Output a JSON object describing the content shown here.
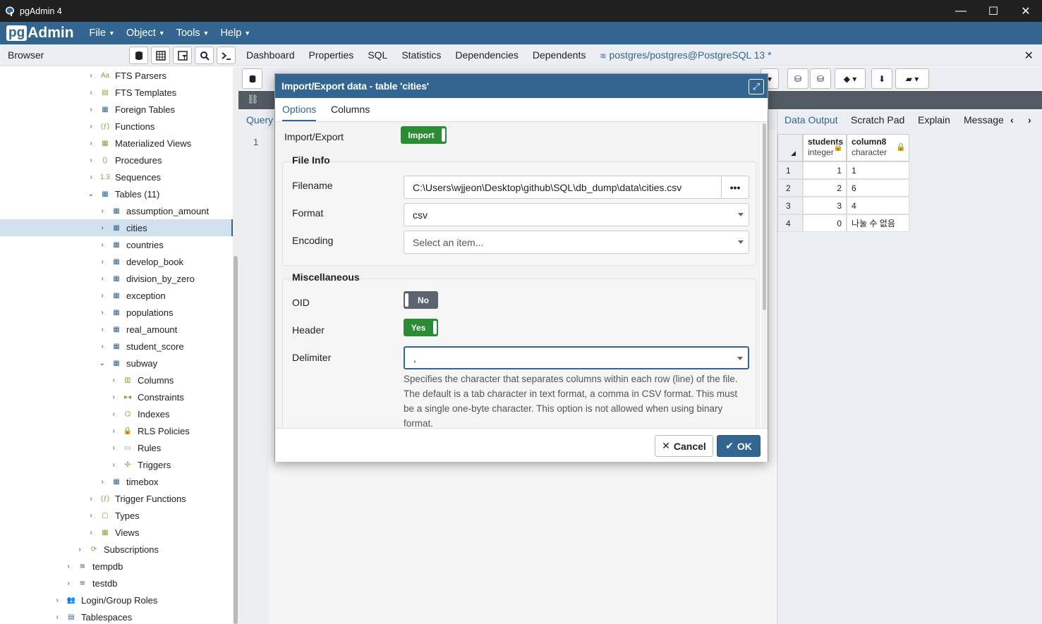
{
  "window": {
    "title": "pgAdmin 4",
    "minimize": "—",
    "maximize": "☐",
    "close": "✕"
  },
  "menubar": {
    "logo_pg": "pg",
    "logo_admin": "Admin",
    "items": [
      "File",
      "Object",
      "Tools",
      "Help"
    ]
  },
  "browser": {
    "title": "Browser",
    "tree": [
      {
        "label": "FTS Parsers",
        "icon": "fts-parsers-icon",
        "glyph": "Aa",
        "indent": 1,
        "chev": "›"
      },
      {
        "label": "FTS Templates",
        "icon": "fts-templates-icon",
        "glyph": "▤",
        "indent": 1,
        "chev": "›"
      },
      {
        "label": "Foreign Tables",
        "icon": "foreign-table-icon",
        "glyph": "▦",
        "indent": 1,
        "chev": "›"
      },
      {
        "label": "Functions",
        "icon": "function-icon",
        "glyph": "(ƒ)",
        "indent": 1,
        "chev": "›"
      },
      {
        "label": "Materialized Views",
        "icon": "materialized-view-icon",
        "glyph": "▦",
        "indent": 1,
        "chev": "›"
      },
      {
        "label": "Procedures",
        "icon": "procedure-icon",
        "glyph": "()",
        "indent": 1,
        "chev": "›"
      },
      {
        "label": "Sequences",
        "icon": "sequence-icon",
        "glyph": "1.3",
        "indent": 1,
        "chev": "›"
      },
      {
        "label": "Tables (11)",
        "icon": "tables-icon",
        "glyph": "▦",
        "indent": 1,
        "chev": "⌄"
      },
      {
        "label": "assumption_amount",
        "icon": "table-icon",
        "glyph": "▦",
        "indent": 2,
        "chev": "›"
      },
      {
        "label": "cities",
        "icon": "table-icon",
        "glyph": "▦",
        "indent": 2,
        "chev": "›",
        "selected": true
      },
      {
        "label": "countries",
        "icon": "table-icon",
        "glyph": "▦",
        "indent": 2,
        "chev": "›"
      },
      {
        "label": "develop_book",
        "icon": "table-icon",
        "glyph": "▦",
        "indent": 2,
        "chev": "›"
      },
      {
        "label": "division_by_zero",
        "icon": "table-icon",
        "glyph": "▦",
        "indent": 2,
        "chev": "›"
      },
      {
        "label": "exception",
        "icon": "table-icon",
        "glyph": "▦",
        "indent": 2,
        "chev": "›"
      },
      {
        "label": "populations",
        "icon": "table-icon",
        "glyph": "▦",
        "indent": 2,
        "chev": "›"
      },
      {
        "label": "real_amount",
        "icon": "table-icon",
        "glyph": "▦",
        "indent": 2,
        "chev": "›"
      },
      {
        "label": "student_score",
        "icon": "table-icon",
        "glyph": "▦",
        "indent": 2,
        "chev": "›"
      },
      {
        "label": "subway",
        "icon": "table-icon",
        "glyph": "▦",
        "indent": 2,
        "chev": "⌄"
      },
      {
        "label": "Columns",
        "icon": "columns-icon",
        "glyph": "▥",
        "indent": 3,
        "chev": "›"
      },
      {
        "label": "Constraints",
        "icon": "constraints-icon",
        "glyph": "▸◂",
        "indent": 3,
        "chev": "›"
      },
      {
        "label": "Indexes",
        "icon": "indexes-icon",
        "glyph": "⌬",
        "indent": 3,
        "chev": "›"
      },
      {
        "label": "RLS Policies",
        "icon": "rls-policy-icon",
        "glyph": "🔒",
        "indent": 3,
        "chev": "›"
      },
      {
        "label": "Rules",
        "icon": "rules-icon",
        "glyph": "▭",
        "indent": 3,
        "chev": "›"
      },
      {
        "label": "Triggers",
        "icon": "trigger-icon",
        "glyph": "✣",
        "indent": 3,
        "chev": "›"
      },
      {
        "label": "timebox",
        "icon": "table-icon",
        "glyph": "▦",
        "indent": 2,
        "chev": "›"
      },
      {
        "label": "Trigger Functions",
        "icon": "trigger-function-icon",
        "glyph": "(ƒ)",
        "indent": 1,
        "chev": "›"
      },
      {
        "label": "Types",
        "icon": "types-icon",
        "glyph": "▢",
        "indent": 1,
        "chev": "›"
      },
      {
        "label": "Views",
        "icon": "views-icon",
        "glyph": "▦",
        "indent": 1,
        "chev": "›"
      },
      {
        "label": "Subscriptions",
        "icon": "subscriptions-icon",
        "glyph": "⟳",
        "indent": 0,
        "chev": "›"
      },
      {
        "label": "tempdb",
        "icon": "database-icon",
        "glyph": "≋",
        "indent": -1,
        "chev": "›"
      },
      {
        "label": "testdb",
        "icon": "database-icon",
        "glyph": "≋",
        "indent": -1,
        "chev": "›"
      },
      {
        "label": "Login/Group Roles",
        "icon": "roles-icon",
        "glyph": "👥",
        "indent": -2,
        "chev": "›"
      },
      {
        "label": "Tablespaces",
        "icon": "tablespace-icon",
        "glyph": "▤",
        "indent": -2,
        "chev": "›"
      }
    ]
  },
  "main_tabs": [
    "Dashboard",
    "Properties",
    "SQL",
    "Statistics",
    "Dependencies",
    "Dependents"
  ],
  "query_tab": {
    "label": "postgres/postgres@PostgreSQL 13 *"
  },
  "query_tool": {
    "subtab": "Query",
    "line_no": "1"
  },
  "data_output": {
    "tabs": [
      "Data Output",
      "Scratch Pad",
      "Explain",
      "Message"
    ],
    "columns": [
      {
        "name": "students",
        "type": "integer"
      },
      {
        "name": "column8",
        "type": "character"
      }
    ],
    "rows": [
      {
        "idx": "1",
        "a": "1",
        "b": "1"
      },
      {
        "idx": "2",
        "a": "2",
        "b": "6"
      },
      {
        "idx": "3",
        "a": "3",
        "b": "4"
      },
      {
        "idx": "4",
        "a": "0",
        "b": "나눌 수 없음"
      }
    ]
  },
  "dialog": {
    "title": "Import/Export data - table 'cities'",
    "tabs": [
      "Options",
      "Columns"
    ],
    "import_export_label": "Import/Export",
    "import_export_value": "Import",
    "file_info_title": "File Info",
    "filename_label": "Filename",
    "filename_value": "C:\\Users\\wjjeon\\Desktop\\github\\SQL\\db_dump\\data\\cities.csv",
    "format_label": "Format",
    "format_value": "csv",
    "encoding_label": "Encoding",
    "encoding_placeholder": "Select an item...",
    "misc_title": "Miscellaneous",
    "oid_label": "OID",
    "oid_value": "No",
    "header_label": "Header",
    "header_value": "Yes",
    "delimiter_label": "Delimiter",
    "delimiter_value": ",",
    "delimiter_help": "Specifies the character that separates columns within each row (line) of the file. The default is a tab character in text format, a comma in CSV format. This must be a single one-byte character. This option is not allowed when using binary format.",
    "cancel_label": "Cancel",
    "ok_label": "OK"
  },
  "colors": {
    "brand": "#326690",
    "toggle_on": "#2c8c35",
    "toggle_off": "#5b6470"
  }
}
